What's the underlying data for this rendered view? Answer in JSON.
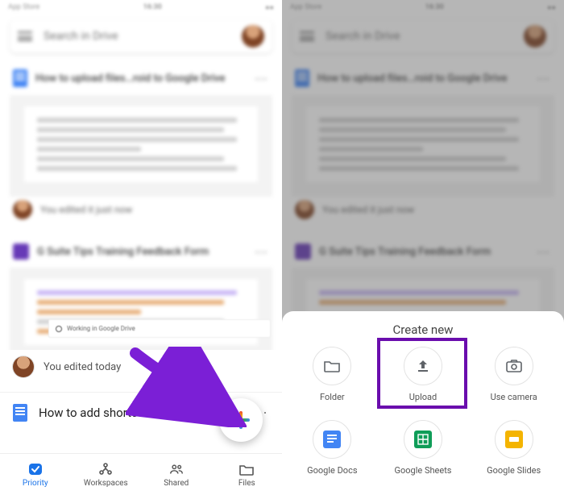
{
  "status": {
    "left": "App Store",
    "time": "16:30"
  },
  "search_placeholder": "Search in Drive",
  "cards": {
    "doc_title": "How to upload files…roid to Google Drive",
    "form_title": "G Suite Tips Training Feedback Form",
    "working": "Working in Google Drive",
    "edited_now": "You edited it just now"
  },
  "left": {
    "edited": "You edited today",
    "file_row": "How to add shortcuts in Google Drive",
    "tabs": [
      "Priority",
      "Workspaces",
      "Shared",
      "Files"
    ]
  },
  "sheet": {
    "title": "Create new",
    "opts": [
      "Folder",
      "Upload",
      "Use camera",
      "Google Docs",
      "Google Sheets",
      "Google Slides"
    ]
  }
}
